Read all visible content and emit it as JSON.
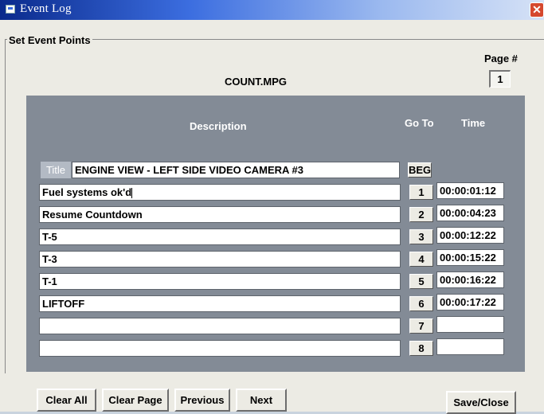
{
  "window": {
    "title": "Event Log",
    "close_glyph": "✕"
  },
  "group_label": "Set Event Points",
  "page": {
    "label": "Page #",
    "value": "1"
  },
  "filename": "COUNT.MPG",
  "headers": {
    "description": "Description",
    "goto": "Go To",
    "time": "Time"
  },
  "title_row": {
    "chip": "Title",
    "value": "ENGINE VIEW - LEFT SIDE VIDEO CAMERA #3",
    "goto": "BEG"
  },
  "rows": [
    {
      "desc": "Fuel systems ok'd",
      "goto": "1",
      "time": "00:00:01:12"
    },
    {
      "desc": "Resume Countdown",
      "goto": "2",
      "time": "00:00:04:23"
    },
    {
      "desc": "T-5",
      "goto": "3",
      "time": "00:00:12:22"
    },
    {
      "desc": "T-3",
      "goto": "4",
      "time": "00:00:15:22"
    },
    {
      "desc": "T-1",
      "goto": "5",
      "time": "00:00:16:22"
    },
    {
      "desc": "LIFTOFF",
      "goto": "6",
      "time": "00:00:17:22"
    },
    {
      "desc": "",
      "goto": "7",
      "time": ""
    },
    {
      "desc": "",
      "goto": "8",
      "time": ""
    }
  ],
  "buttons": {
    "clear_all": "Clear All",
    "clear_page": "Clear Page",
    "previous": "Previous",
    "next": "Next",
    "save_close": "Save/Close"
  },
  "colors": {
    "titlebar": "#0a2a8c",
    "panel": "#838b96",
    "dialog": "#ecebe4"
  }
}
